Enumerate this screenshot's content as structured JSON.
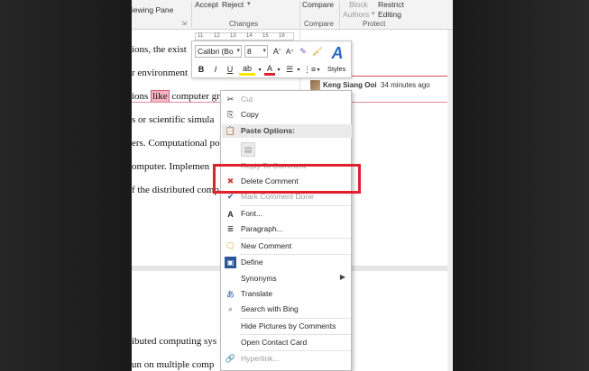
{
  "ribbon": {
    "reviewing_pane": "iewing Pane",
    "accept": "Accept",
    "reject": "Reject",
    "compare": "Compare",
    "block_authors_1": "Block",
    "block_authors_2": "Authors",
    "restrict_editing_1": "Restrict",
    "restrict_editing_2": "Editing",
    "group_changes": "Changes",
    "group_compare": "Compare",
    "group_protect": "Protect"
  },
  "ruler": {
    "ticks": [
      "11",
      "12",
      "13",
      "14",
      "15",
      "16"
    ]
  },
  "document": {
    "line1": "ions, the exist",
    "line2": "r environment",
    "line3_pre": "ions ",
    "line3_hl": "like",
    "line3_post": " computer gra",
    "line4": "s or scientific simula",
    "line5": "ers. Computational po",
    "line6": "omputer. Implemen",
    "line7": "f the distributed comp",
    "line8": "ibuted computing sys",
    "line9": "un on multiple comp"
  },
  "comment": {
    "author": "Keng Siang Ooi",
    "time": "34 minutes ago"
  },
  "mini_toolbar": {
    "font": "Calibri (Bo",
    "size": "8",
    "bold": "B",
    "italic": "I",
    "underline": "U",
    "styles": "Styles"
  },
  "menu": {
    "cut": "Cut",
    "copy": "Copy",
    "paste_options": "Paste Options:",
    "reply": "Reply To Comment",
    "delete": "Delete Comment",
    "mark_done": "Mark Comment Done",
    "font": "Font...",
    "paragraph": "Paragraph...",
    "new_comment": "New Comment",
    "define": "Define",
    "synonyms": "Synonyms",
    "translate": "Translate",
    "search_bing": "Search with Bing",
    "hide_pictures": "Hide Pictures by Comments",
    "open_contact": "Open Contact Card",
    "hyperlink": "Hyperlink..."
  },
  "colors": {
    "highlight_box": "#e0212d",
    "comment_highlight": "#f4b6c2",
    "define_icon": "#2b5797"
  }
}
